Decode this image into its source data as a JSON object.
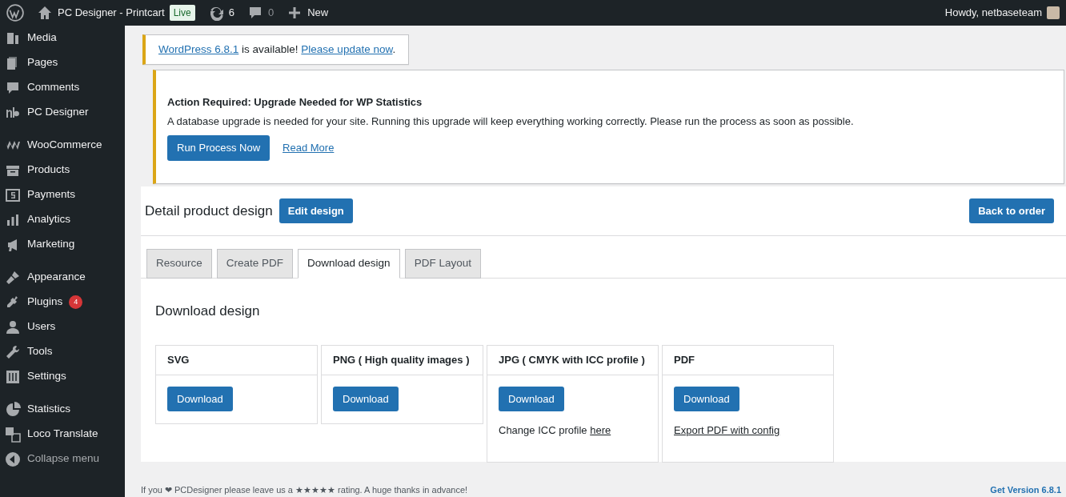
{
  "admin_bar": {
    "site": "PC Designer - Printcart",
    "live_badge": "Live",
    "updates": "6",
    "comments": "0",
    "new": "New",
    "greeting": "Howdy, netbaseteam"
  },
  "sidebar": {
    "groups": [
      {
        "items": [
          {
            "label": "Media"
          },
          {
            "label": "Pages"
          },
          {
            "label": "Comments"
          },
          {
            "label": "PC Designer"
          }
        ]
      },
      {
        "items": [
          {
            "label": "WooCommerce"
          },
          {
            "label": "Products"
          },
          {
            "label": "Payments"
          },
          {
            "label": "Analytics"
          },
          {
            "label": "Marketing"
          }
        ]
      },
      {
        "items": [
          {
            "label": "Appearance"
          },
          {
            "label": "Plugins",
            "badge": "4"
          },
          {
            "label": "Users"
          },
          {
            "label": "Tools"
          },
          {
            "label": "Settings"
          }
        ]
      },
      {
        "items": [
          {
            "label": "Statistics"
          },
          {
            "label": "Loco Translate"
          }
        ]
      }
    ],
    "collapse": "Collapse menu"
  },
  "update_notice": {
    "link": "WordPress 6.8.1",
    "text": " is available! ",
    "action": "Please update now",
    "end": "."
  },
  "upgrade_notice": {
    "title": "Action Required: Upgrade Needed for WP Statistics",
    "message": "A database upgrade is needed for your site. Running this upgrade will keep everything working correctly. Please run the process as soon as possible.",
    "button": "Run Process Now",
    "link": "Read More"
  },
  "design": {
    "title": "Detail product design",
    "edit_button": "Edit design",
    "back_button": "Back to order",
    "tabs": [
      {
        "label": "Resource",
        "selected": false
      },
      {
        "label": "Create PDF",
        "selected": false
      },
      {
        "label": "Download design",
        "selected": true
      },
      {
        "label": "PDF Layout",
        "selected": false
      }
    ],
    "heading": "Download design",
    "formats": [
      {
        "title": "SVG",
        "button": "Download"
      },
      {
        "title": "PNG ( High quality images )",
        "button": "Download"
      },
      {
        "title": "JPG ( CMYK with ICC profile )",
        "button": "Download",
        "note": "Change ICC profile ",
        "note_link": "here"
      },
      {
        "title": "PDF",
        "button": "Download",
        "note_link": "Export PDF with config"
      }
    ]
  },
  "footer": {
    "text": "If you ❤ PCDesigner please leave us a ★★★★★ rating. A huge thanks in advance!",
    "version": "Get Version 6.8.1"
  }
}
